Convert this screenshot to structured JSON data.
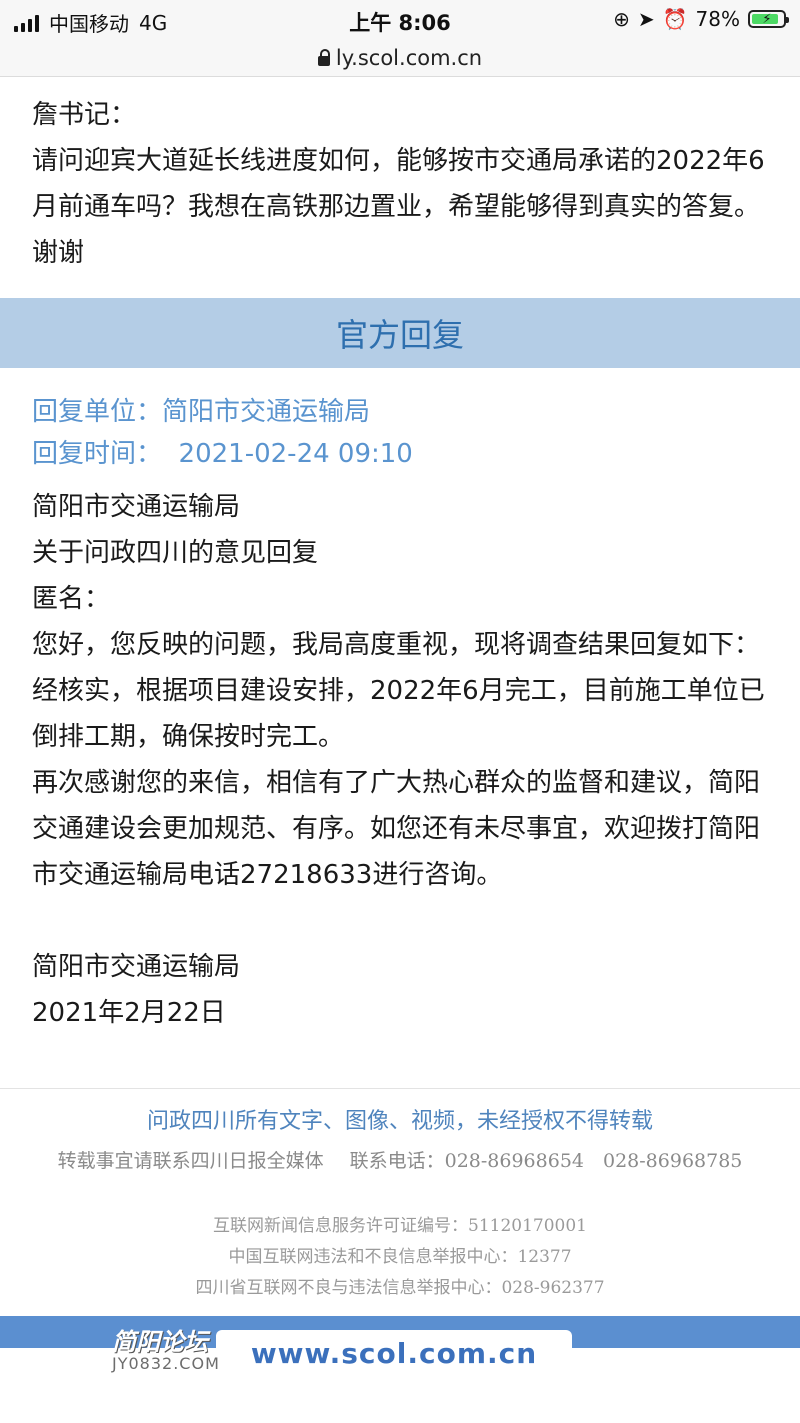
{
  "status_bar": {
    "carrier": "中国移动",
    "network": "4G",
    "time": "上午 8:06",
    "battery_percent": "78%"
  },
  "url_bar": {
    "url": "ly.scol.com.cn"
  },
  "question": {
    "salutation": "詹书记：",
    "body": "请问迎宾大道延长线进度如何，能够按市交通局承诺的2022年6月前通车吗？我想在高铁那边置业，希望能够得到真实的答复。谢谢"
  },
  "official_reply": {
    "header": "官方回复",
    "unit_label": "回复单位：",
    "unit_value": "简阳市交通运输局",
    "time_label": "回复时间：",
    "time_value": "2021-02-24 09:10",
    "lines": {
      "org": "简阳市交通运输局",
      "subject": "关于问政四川的意见回复",
      "addressee": "匿名：",
      "p1": "您好，您反映的问题，我局高度重视，现将调查结果回复如下：",
      "p2": "经核实，根据项目建设安排，2022年6月完工，目前施工单位已倒排工期，确保按时完工。",
      "p3": "再次感谢您的来信，相信有了广大热心群众的监督和建议，简阳交通建设会更加规范、有序。如您还有未尽事宜，欢迎拨打简阳市交通运输局电话27218633进行咨询。",
      "signature": "简阳市交通运输局",
      "date": "2021年2月22日"
    }
  },
  "footer": {
    "copyright": "问政四川所有文字、图像、视频，未经授权不得转载",
    "reprint": "转载事宜请联系四川日报全媒体",
    "contact": "联系电话：028-86968654　028-86968785",
    "license": "互联网新闻信息服务许可证编号：51120170001",
    "report_center": "中国互联网违法和不良信息举报中心：12377",
    "sichuan_report": "四川省互联网不良与违法信息举报中心：028-962377",
    "site": "www.scol.com.cn",
    "watermark_title": "简阳论坛",
    "watermark_domain": "JY0832.COM"
  },
  "colors": {
    "header_bar_bg": "#b4cde6",
    "header_text": "#2e6fae",
    "meta_text": "#5a94cf",
    "footer_band": "#5b8fd0"
  }
}
